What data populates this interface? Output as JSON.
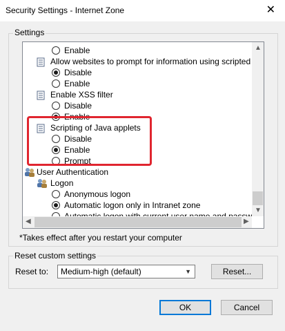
{
  "window": {
    "title": "Security Settings - Internet Zone",
    "close_glyph": "✕"
  },
  "settings_group": {
    "label": "Settings",
    "items": {
      "enable_1": "Enable",
      "allow_websites_prompt": "Allow websites to prompt for information using scripted windo",
      "disable_1": "Disable",
      "enable_2": "Enable",
      "enable_xss": "Enable XSS filter",
      "disable_2": "Disable",
      "enable_3": "Enable",
      "scripting_java": "Scripting of Java applets",
      "disable_3": "Disable",
      "enable_4": "Enable",
      "prompt_4": "Prompt",
      "user_auth": "User Authentication",
      "logon": "Logon",
      "anon_logon": "Anonymous logon",
      "auto_logon_intranet": "Automatic logon only in Intranet zone",
      "auto_logon_current": "Automatic logon with current user name and password"
    },
    "footnote": "*Takes effect after you restart your computer"
  },
  "reset_group": {
    "label": "Reset custom settings",
    "reset_to_label": "Reset to:",
    "selected_option": "Medium-high (default)",
    "reset_button": "Reset..."
  },
  "footer": {
    "ok_button": "OK",
    "cancel_button": "Cancel"
  },
  "colors": {
    "highlight": "#e0252f",
    "accent": "#0078d7"
  }
}
